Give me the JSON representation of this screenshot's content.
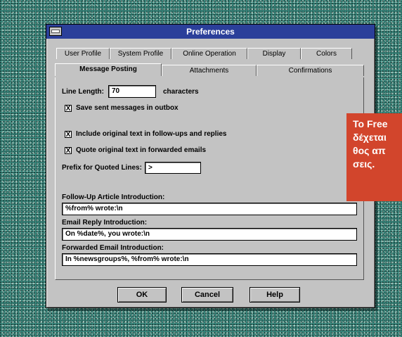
{
  "window": {
    "title": "Preferences"
  },
  "tabs_back": [
    "User Profile",
    "System Profile",
    "Online Operation",
    "Display",
    "Colors"
  ],
  "tabs_front": [
    "Message Posting",
    "Attachments",
    "Confirmations"
  ],
  "form": {
    "line_length_label": "Line Length:",
    "line_length_value": "70",
    "line_length_unit": "characters",
    "save_sent_label": "Save sent messages in outbox",
    "save_sent_checked": true,
    "include_original_label": "Include original text in follow-ups and replies",
    "include_original_checked": true,
    "quote_original_label": "Quote original text in forwarded emails",
    "quote_original_checked": true,
    "prefix_label": "Prefix for Quoted Lines:",
    "prefix_value": ">",
    "followup_label": "Follow-Up Article Introduction:",
    "followup_value": "%from% wrote:\\n",
    "email_reply_label": "Email Reply Introduction:",
    "email_reply_value": "On %date%, you wrote:\\n",
    "forwarded_label": "Forwarded Email Introduction:",
    "forwarded_value": "In %newsgroups%, %from% wrote:\\n"
  },
  "buttons": {
    "ok": "OK",
    "cancel": "Cancel",
    "help": "Help"
  },
  "check_mark": "X",
  "callout": {
    "lines": [
      "Το Free",
      "δέχεται",
      "θος απ",
      "σεις."
    ]
  },
  "colors": {
    "titlebar": "#2b3f9a",
    "dialog": "#c3c3c3",
    "callout": "#d2452c",
    "background": "#3b8f84"
  }
}
